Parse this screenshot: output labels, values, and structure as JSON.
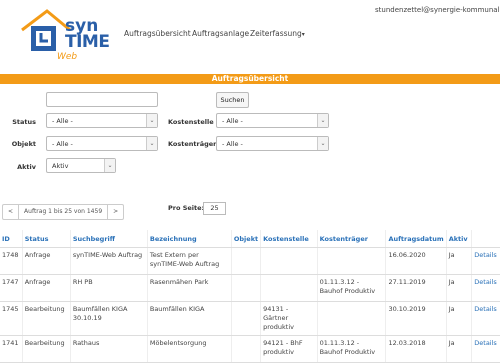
{
  "header": {
    "logo_text_line1": "syn",
    "logo_text_line2": "TIME",
    "logo_sub": "Web",
    "user_email": "stundenzettel@synergie-kommunal.de",
    "nav": [
      {
        "label": "Auftragsübersicht"
      },
      {
        "label": "Auftragsanlage"
      },
      {
        "label": "Zeiterfassung"
      }
    ]
  },
  "colors": {
    "accent": "#f39b17",
    "link": "#2a71b8",
    "logo_blue": "#2a5fa8"
  },
  "page_title": "Auftragsübersicht",
  "filters": {
    "search_value": "",
    "search_button": "Suchen",
    "status": {
      "label": "Status",
      "value": "- Alle -"
    },
    "kostenstelle": {
      "label": "Kostenstelle",
      "value": "- Alle -"
    },
    "objekt": {
      "label": "Objekt",
      "value": "- Alle -"
    },
    "kostentraeger": {
      "label": "Kostenträger",
      "value": "- Alle -"
    },
    "aktiv": {
      "label": "Aktiv",
      "value": "Aktiv"
    }
  },
  "pagination": {
    "prev": "<",
    "info": "Auftrag 1 bis 25 von 1459",
    "next": ">",
    "per_page_label": "Pro Seite:",
    "per_page_value": "25"
  },
  "table": {
    "headers": [
      "ID",
      "Status",
      "Suchbegriff",
      "Bezeichnung",
      "Objekt",
      "Kostenstelle",
      "Kostenträger",
      "Auftragsdatum",
      "Aktiv",
      ""
    ],
    "rows": [
      {
        "id": "1748",
        "status": "Anfrage",
        "suchbegriff": "synTIME-Web Auftrag",
        "bezeichnung": "Test Extern per synTIME-Web Auftrag",
        "objekt": "",
        "kostenstelle": "",
        "kostentraeger": "",
        "datum": "16.06.2020",
        "aktiv": "Ja",
        "link": "Details"
      },
      {
        "id": "1747",
        "status": "Anfrage",
        "suchbegriff": "RH PB",
        "bezeichnung": "Rasenmähen Park",
        "objekt": "",
        "kostenstelle": "",
        "kostentraeger": "01.11.3.12 - Bauhof Produktiv",
        "datum": "27.11.2019",
        "aktiv": "Ja",
        "link": "Details"
      },
      {
        "id": "1745",
        "status": "Bearbeitung",
        "suchbegriff": "Baumfällen KIGA 30.10.19",
        "bezeichnung": "Baumfällen KIGA",
        "objekt": "",
        "kostenstelle": "94131 - Gärtner produktiv",
        "kostentraeger": "",
        "datum": "30.10.2019",
        "aktiv": "Ja",
        "link": "Details"
      },
      {
        "id": "1741",
        "status": "Bearbeitung",
        "suchbegriff": "Rathaus",
        "bezeichnung": "Möbelentsorgung",
        "objekt": "",
        "kostenstelle": "94121 - BhF produktiv",
        "kostentraeger": "01.11.3.12 - Bauhof Produktiv",
        "datum": "12.03.2018",
        "aktiv": "Ja",
        "link": "Details"
      }
    ]
  }
}
